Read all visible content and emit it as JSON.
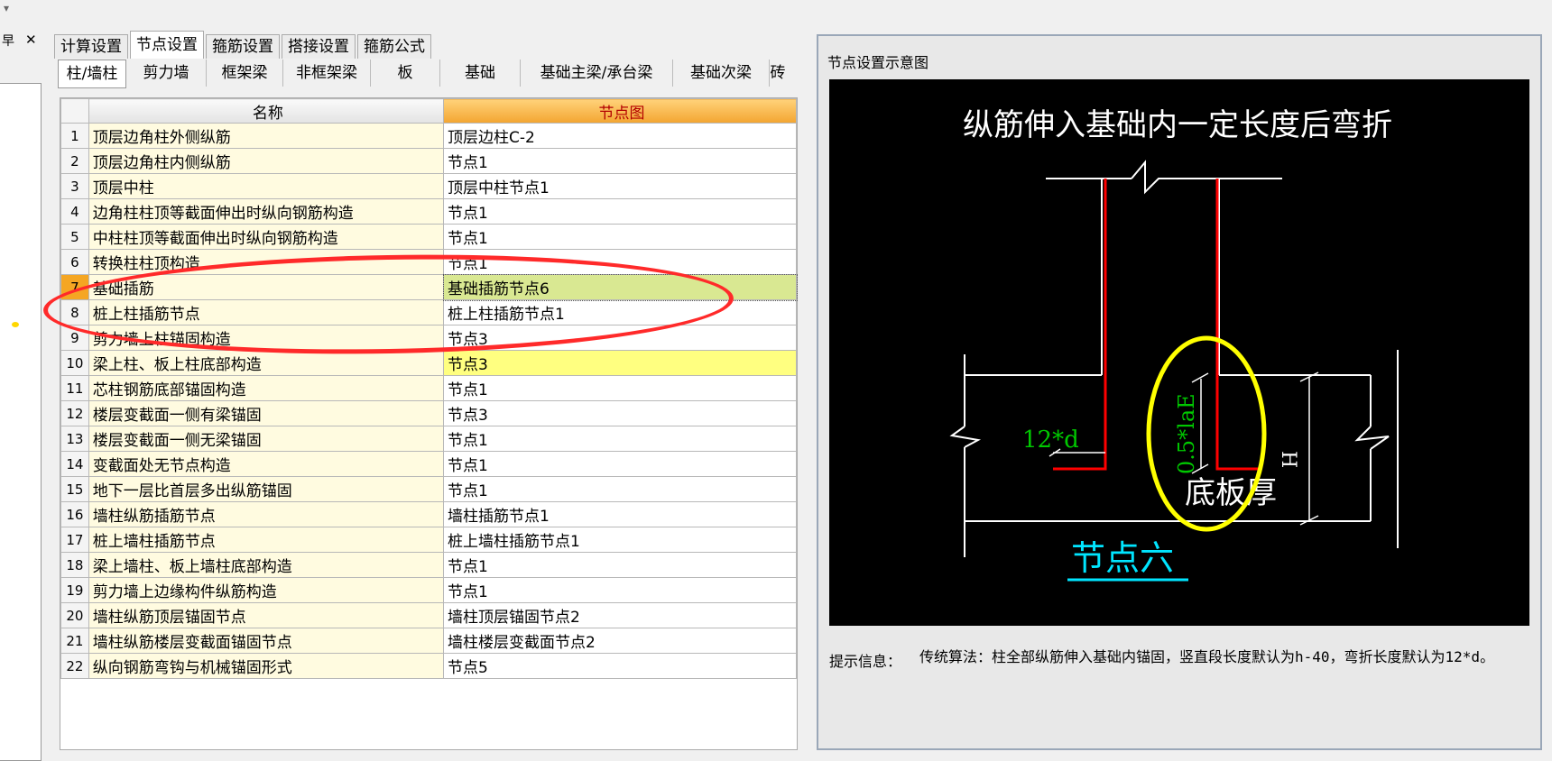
{
  "toolbar": {
    "dropdown_glyph": "▾"
  },
  "left_panel": {
    "pin_glyph": "早",
    "close_glyph": "✕"
  },
  "main_tabs": [
    "计算设置",
    "节点设置",
    "箍筋设置",
    "搭接设置",
    "箍筋公式"
  ],
  "sub_tabs": [
    "柱/墙柱",
    "剪力墙",
    "框架梁",
    "非框架梁",
    "板",
    "基础",
    "基础主梁/承台梁",
    "基础次梁",
    "砖"
  ],
  "table": {
    "headers": {
      "name": "名称",
      "node": "节点图"
    },
    "rows": [
      {
        "no": "1",
        "name": "顶层边角柱外侧纵筋",
        "node": "顶层边柱C-2"
      },
      {
        "no": "2",
        "name": "顶层边角柱内侧纵筋",
        "node": "节点1"
      },
      {
        "no": "3",
        "name": "顶层中柱",
        "node": "顶层中柱节点1"
      },
      {
        "no": "4",
        "name": "边角柱柱顶等截面伸出时纵向钢筋构造",
        "node": "节点1"
      },
      {
        "no": "5",
        "name": "中柱柱顶等截面伸出时纵向钢筋构造",
        "node": "节点1"
      },
      {
        "no": "6",
        "name": "转换柱柱顶构造",
        "node": "节点1"
      },
      {
        "no": "7",
        "name": "基础插筋",
        "node": "基础插筋节点6"
      },
      {
        "no": "8",
        "name": "桩上柱插筋节点",
        "node": "桩上柱插筋节点1"
      },
      {
        "no": "9",
        "name": "剪力墙上柱锚固构造",
        "node": "节点3"
      },
      {
        "no": "10",
        "name": "梁上柱、板上柱底部构造",
        "node": "节点3"
      },
      {
        "no": "11",
        "name": "芯柱钢筋底部锚固构造",
        "node": "节点1"
      },
      {
        "no": "12",
        "name": "楼层变截面一侧有梁锚固",
        "node": "节点3"
      },
      {
        "no": "13",
        "name": "楼层变截面一侧无梁锚固",
        "node": "节点1"
      },
      {
        "no": "14",
        "name": "变截面处无节点构造",
        "node": "节点1"
      },
      {
        "no": "15",
        "name": "地下一层比首层多出纵筋锚固",
        "node": "节点1"
      },
      {
        "no": "16",
        "name": "墙柱纵筋插筋节点",
        "node": "墙柱插筋节点1"
      },
      {
        "no": "17",
        "name": "桩上墙柱插筋节点",
        "node": "桩上墙柱插筋节点1"
      },
      {
        "no": "18",
        "name": "梁上墙柱、板上墙柱底部构造",
        "node": "节点1"
      },
      {
        "no": "19",
        "name": "剪力墙上边缘构件纵筋构造",
        "node": "节点1"
      },
      {
        "no": "20",
        "name": "墙柱纵筋顶层锚固节点",
        "node": "墙柱顶层锚固节点2"
      },
      {
        "no": "21",
        "name": "墙柱纵筋楼层变截面锚固节点",
        "node": "墙柱楼层变截面节点2"
      },
      {
        "no": "22",
        "name": "纵向钢筋弯钩与机械锚固形式",
        "node": "节点5"
      }
    ]
  },
  "diagram": {
    "panel_title": "节点设置示意图",
    "heading": "纵筋伸入基础内一定长度后弯折",
    "label_hook": "12*d",
    "label_anchor": "0.5*laE",
    "label_h": "H",
    "label_slab": "底板厚",
    "caption": "节点六",
    "colors": {
      "rebar": "#ff0000",
      "dim_green": "#00c800",
      "caption": "#00e5ff",
      "annotation": "#ffff00",
      "lines": "#ffffff"
    }
  },
  "hint": {
    "label": "提示信息：",
    "text": "传统算法：柱全部纵筋伸入基础内锚固，竖直段长度默认为h-40，弯折长度默认为12*d。"
  }
}
